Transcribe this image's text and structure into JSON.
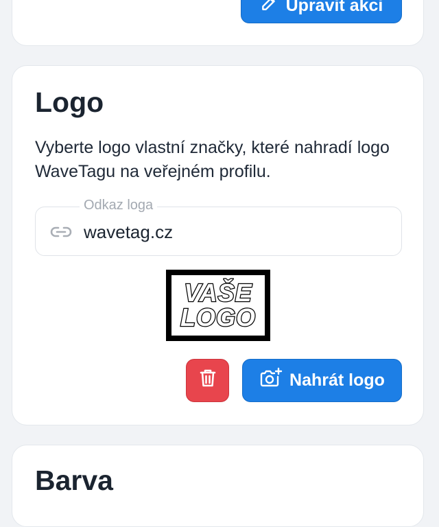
{
  "top_card": {
    "edit_button_label": "Upravit akci"
  },
  "logo_section": {
    "title": "Logo",
    "description": "Vyberte logo vlastní značky, které nahradí logo WaveTagu na veřejném profilu.",
    "link_field": {
      "label": "Odkaz loga",
      "value": "wavetag.cz",
      "icon": "link-icon"
    },
    "logo_preview": {
      "line1": "VAŠE",
      "line2": "LOGO"
    },
    "delete_button": {
      "icon": "trash-icon"
    },
    "upload_button": {
      "label": "Nahrát logo",
      "icon": "camera-add-icon"
    }
  },
  "color_section": {
    "title": "Barva"
  },
  "colors": {
    "primary": "#1d7fe6",
    "danger": "#e8454d",
    "background": "#f1f3f6"
  }
}
